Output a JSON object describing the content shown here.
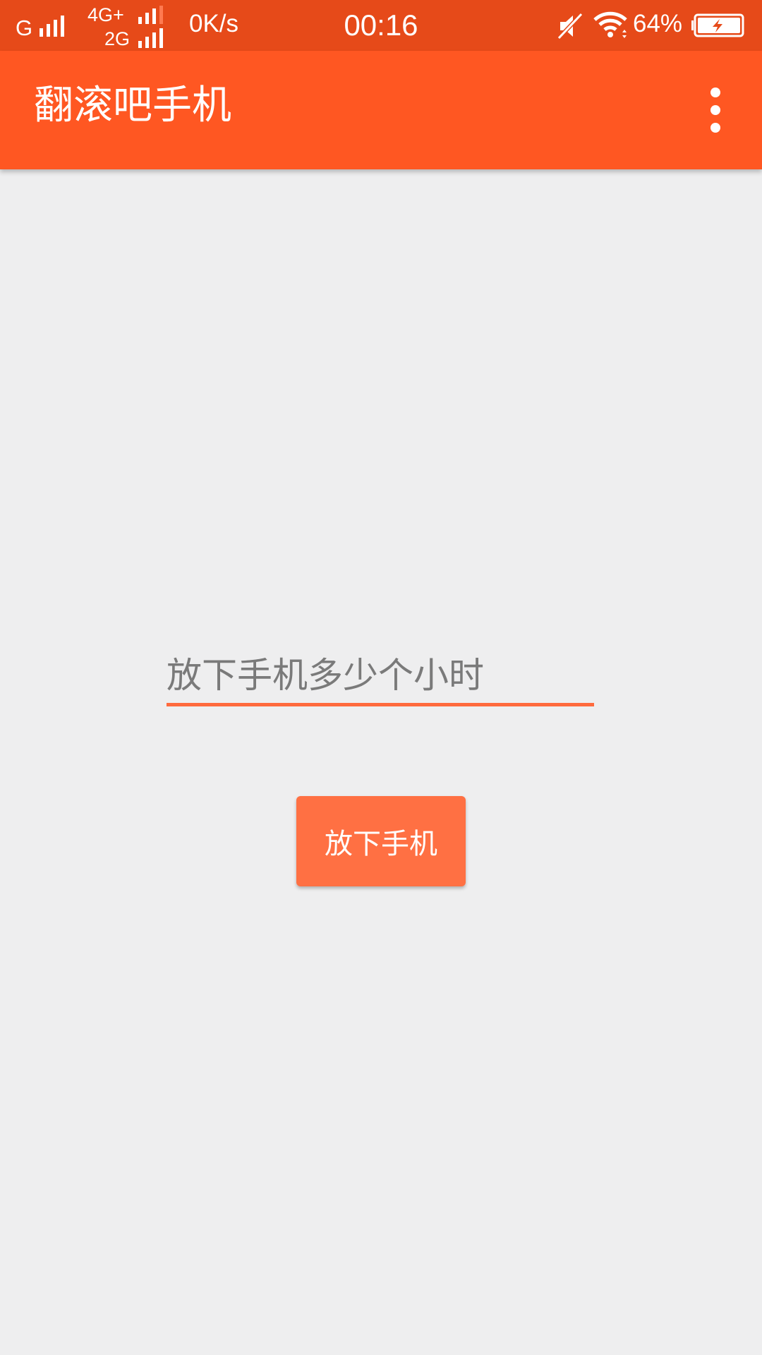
{
  "status_bar": {
    "network_1": "G",
    "network_2_top": "4G+",
    "network_2_bottom": "2G",
    "speed": "0K/s",
    "time": "00:16",
    "battery_percent": "64%",
    "icons": [
      "signal-icon",
      "mute-icon",
      "wifi-icon",
      "battery-charging-icon"
    ]
  },
  "app_bar": {
    "title": "翻滚吧手机",
    "overflow_icon": "more-vert-icon"
  },
  "form": {
    "hours_placeholder": "放下手机多少个小时",
    "hours_value": "",
    "submit_label": "放下手机"
  },
  "colors": {
    "status_bar": "#e64a19",
    "app_bar": "#ff5722",
    "accent": "#ff6a3d",
    "button": "#ff7043",
    "background": "#eeeeef"
  }
}
